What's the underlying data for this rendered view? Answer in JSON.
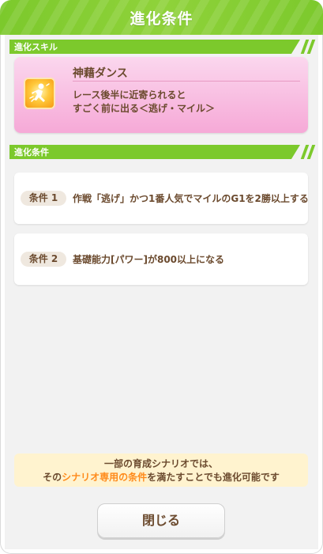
{
  "dialog": {
    "title": "進化条件",
    "skill_section_label": "進化スキル",
    "condition_section_label": "進化条件",
    "skill": {
      "name": "神藉ダンス",
      "description_line1": "レース後半に近寄られると",
      "description_line2": "すごく前に出る＜逃げ・マイル＞",
      "icon": "running-figure-icon"
    },
    "conditions": [
      {
        "label": "条件 1",
        "text": "作戦「逃げ」かつ1番人気でマイルのG1を2勝以上する"
      },
      {
        "label": "条件 2",
        "text": "基礎能力[パワー]が800以上になる"
      }
    ],
    "note": {
      "line1": "一部の育成シナリオでは、",
      "line2_prefix": "その",
      "line2_highlight": "シナリオ専用の条件",
      "line2_suffix": "を満たすことでも進化可能です"
    },
    "close_label": "閉じる"
  },
  "colors": {
    "header_green": "#7cc92c",
    "skill_card_pink": "#f6a9d7",
    "text_brown": "#6b4a2e",
    "highlight_orange": "#ff8a1a",
    "note_background": "#fff3cf"
  }
}
